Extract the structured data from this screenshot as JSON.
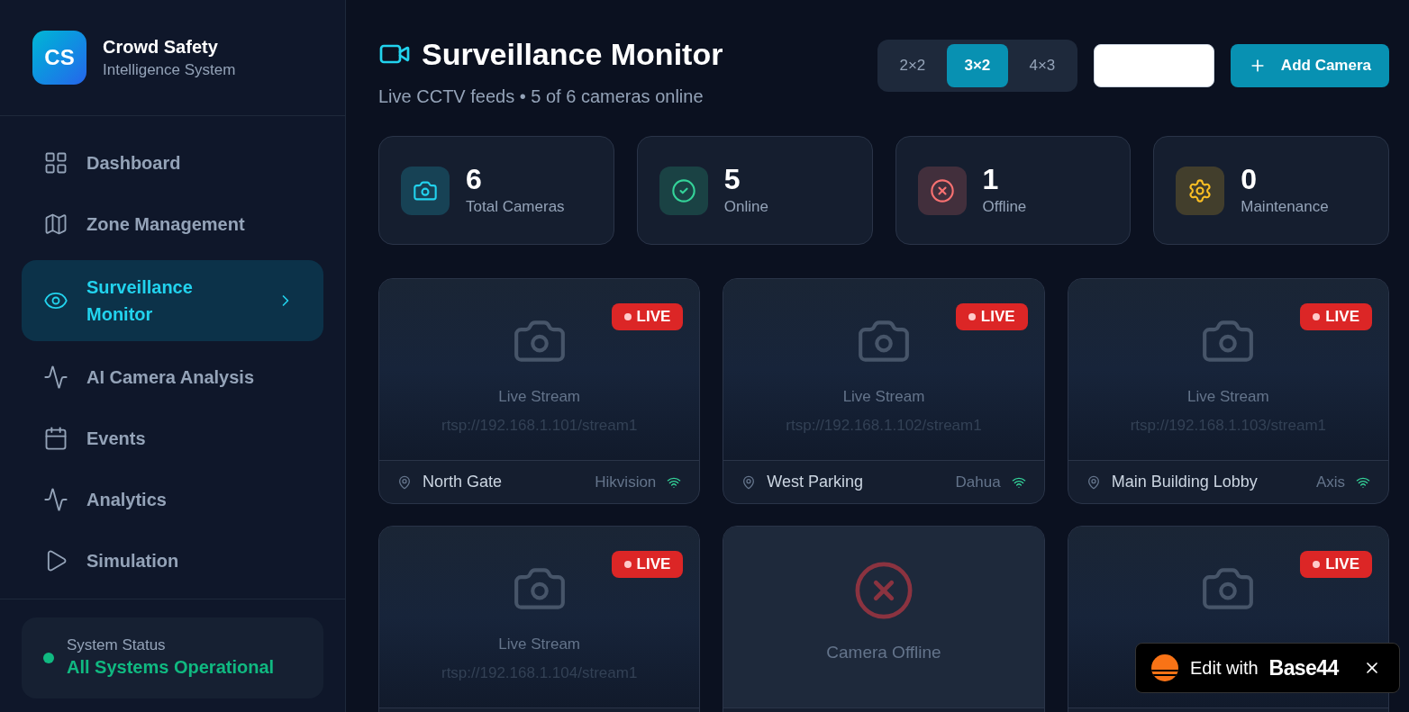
{
  "brand": {
    "logo": "CS",
    "name": "Crowd Safety",
    "subtitle": "Intelligence System"
  },
  "nav": [
    {
      "label": "Dashboard",
      "selected": false
    },
    {
      "label": "Zone Management",
      "selected": false
    },
    {
      "label": "Surveillance Monitor",
      "selected": true
    },
    {
      "label": "AI Camera Analysis",
      "selected": false
    },
    {
      "label": "Events",
      "selected": false
    },
    {
      "label": "Analytics",
      "selected": false
    },
    {
      "label": "Simulation",
      "selected": false
    }
  ],
  "system_status": {
    "label": "System Status",
    "value": "All Systems Operational",
    "color": "#10b981"
  },
  "header": {
    "title": "Surveillance Monitor",
    "subtitle": "Live CCTV feeds • 5 of 6 cameras online"
  },
  "layouts": [
    {
      "label": "2×2",
      "selected": false
    },
    {
      "label": "3×2",
      "selected": true
    },
    {
      "label": "4×3",
      "selected": false
    }
  ],
  "add_button": "Add Camera",
  "stats": [
    {
      "value": "6",
      "label": "Total Cameras",
      "color": "#22d3ee"
    },
    {
      "value": "5",
      "label": "Online",
      "color": "#34d399"
    },
    {
      "value": "1",
      "label": "Offline",
      "color": "#f87171"
    },
    {
      "value": "0",
      "label": "Maintenance",
      "color": "#fbbf24"
    }
  ],
  "cameras": [
    {
      "kind": "live",
      "badge": "LIVE",
      "stream": "Live Stream",
      "url": "rtsp://192.168.1.101/stream1",
      "location": "North Gate",
      "brand": "Hikvision"
    },
    {
      "kind": "live",
      "badge": "LIVE",
      "stream": "Live Stream",
      "url": "rtsp://192.168.1.102/stream1",
      "location": "West Parking",
      "brand": "Dahua"
    },
    {
      "kind": "live",
      "badge": "LIVE",
      "stream": "Live Stream",
      "url": "rtsp://192.168.1.103/stream1",
      "location": "Main Building Lobby",
      "brand": "Axis"
    },
    {
      "kind": "live",
      "badge": "LIVE",
      "stream": "Live Stream",
      "url": "rtsp://192.168.1.104/stream1"
    },
    {
      "kind": "offline",
      "stream": "Camera Offline"
    },
    {
      "kind": "live",
      "badge": "LIVE"
    }
  ],
  "floating_badge": {
    "prefix": "Edit with",
    "brand": "Base44"
  }
}
